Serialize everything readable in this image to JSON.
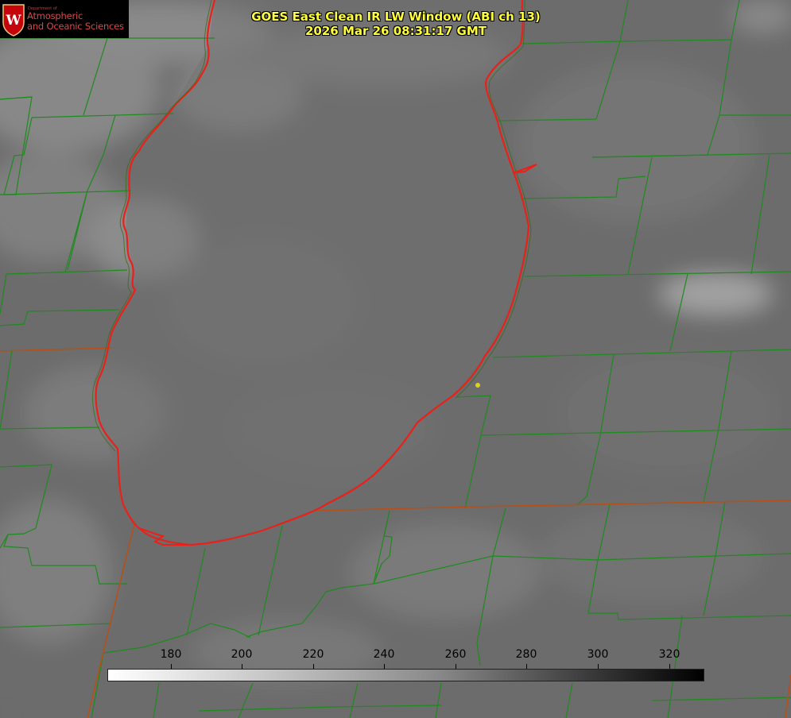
{
  "title": {
    "line1": "GOES East Clean IR LW Window (ABI ch 13)",
    "line2": "2026 Mar 26 08:31:17 GMT"
  },
  "logo": {
    "department": "Department of",
    "line1": "Atmospheric",
    "line2": "and Oceanic Sciences",
    "crest_letter": "W"
  },
  "colorbar": {
    "ticks": [
      "180",
      "200",
      "220",
      "240",
      "260",
      "280",
      "300",
      "320"
    ],
    "range": [
      162,
      330
    ],
    "from_color": "#ffffff",
    "to_color": "#000000"
  },
  "colors": {
    "title": "#ffff3c",
    "lake_outline": "#e8211a",
    "county_lines": "#1f8a1f",
    "state_lines": "#b5501a",
    "marker": "#e0d020"
  }
}
